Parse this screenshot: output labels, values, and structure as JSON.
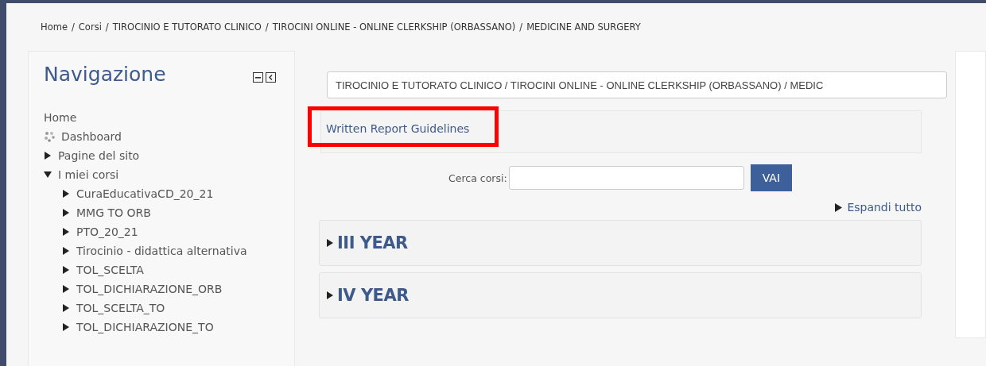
{
  "breadcrumb": {
    "separator": "/",
    "items": [
      "Home",
      "Corsi",
      "TIROCINIO E TUTORATO CLINICO",
      "TIROCINI ONLINE - ONLINE CLERKSHIP (ORBASSANO)",
      "MEDICINE AND SURGERY"
    ]
  },
  "navigation": {
    "title": "Navigazione",
    "items": [
      {
        "label": "Home",
        "kind": "link"
      },
      {
        "label": "Dashboard",
        "kind": "dashboard"
      },
      {
        "label": "Pagine del sito",
        "kind": "branch",
        "expanded": false
      },
      {
        "label": "I miei corsi",
        "kind": "branch",
        "expanded": true,
        "children": [
          {
            "label": "CuraEducativaCD_20_21",
            "expanded": false
          },
          {
            "label": "MMG TO ORB",
            "expanded": false
          },
          {
            "label": "PTO_20_21",
            "expanded": false
          },
          {
            "label": "Tirocinio - didattica alternativa",
            "expanded": false
          },
          {
            "label": "TOL_SCELTA",
            "expanded": false
          },
          {
            "label": "TOL_DICHIARAZIONE_ORB",
            "expanded": false
          },
          {
            "label": "TOL_SCELTA_TO",
            "expanded": false
          },
          {
            "label": "TOL_DICHIARAZIONE_TO",
            "expanded": false
          }
        ]
      }
    ]
  },
  "course_select": {
    "value": "TIROCINIO E TUTORATO CLINICO / TIROCINI ONLINE - ONLINE CLERKSHIP (ORBASSANO) / MEDIC"
  },
  "highlighted_link": "Written Report Guidelines",
  "search": {
    "label": "Cerca corsi:",
    "button": "VAI"
  },
  "expand_all": "Espandi tutto",
  "sections": [
    {
      "title": "III YEAR",
      "expanded": false
    },
    {
      "title": "IV YEAR",
      "expanded": false
    }
  ]
}
